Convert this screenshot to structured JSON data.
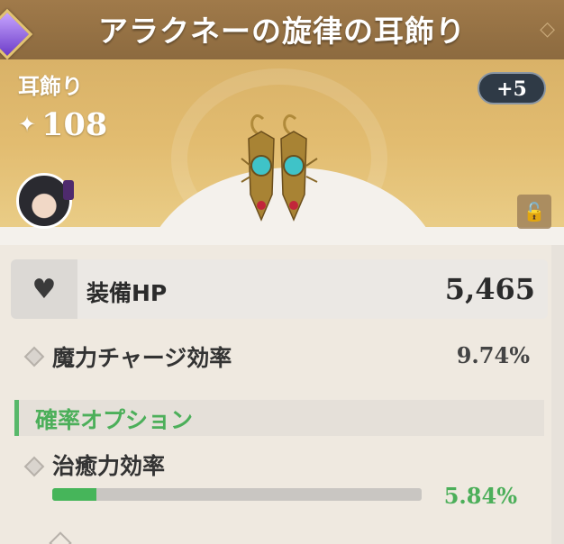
{
  "item": {
    "title": "アラクネーの旋律の耳飾り",
    "type": "耳飾り",
    "power": "108",
    "enhance_level": "+5",
    "icons": {
      "rarity": "purple-gem-icon",
      "power": "sparkle-icon",
      "lock": "unlocked-padlock-icon",
      "main_stat": "heart-icon"
    }
  },
  "stats": {
    "main": {
      "name": "装備HP",
      "value": "5,465"
    },
    "sub": {
      "name": "魔力チャージ効率",
      "value": "9.74%"
    }
  },
  "random_options": {
    "header": "確率オプション",
    "items": [
      {
        "name": "治癒力効率",
        "value": "5.84%",
        "progress": 0.12
      }
    ]
  },
  "colors": {
    "accent_green": "#4caf5a",
    "title_bg": "#a07a4a",
    "header_gold": "#e2bc70"
  }
}
